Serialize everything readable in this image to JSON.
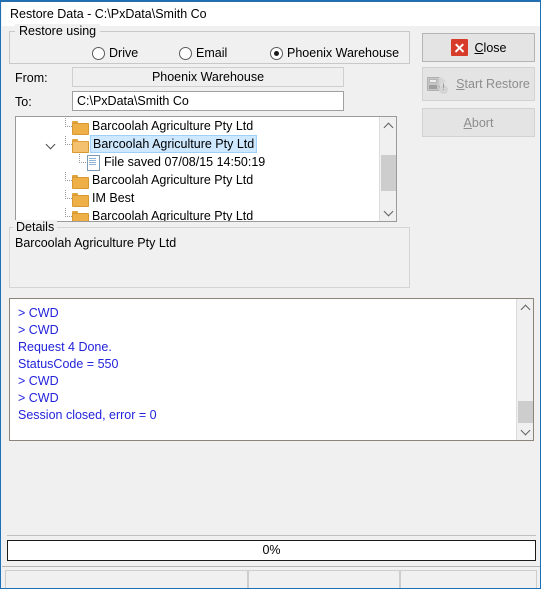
{
  "window": {
    "title": "Restore Data - C:\\PxData\\Smith Co"
  },
  "restore_using": {
    "legend": "Restore using",
    "options": [
      {
        "label": "Drive",
        "selected": false
      },
      {
        "label": "Email",
        "selected": false
      },
      {
        "label": "Phoenix Warehouse",
        "selected": true
      }
    ]
  },
  "fields": {
    "from_label": "From:",
    "from_value": "Phoenix Warehouse",
    "to_label": "To:",
    "to_value": "C:\\PxData\\Smith Co"
  },
  "tree": {
    "rows": [
      {
        "label": "Barcoolah Agriculture Pty Ltd",
        "type": "folder",
        "selected": false,
        "expanded": false
      },
      {
        "label": "Barcoolah Agriculture Pty Ltd",
        "type": "folder-open",
        "selected": true,
        "expanded": true
      },
      {
        "label": "File saved 07/08/15 14:50:19",
        "type": "file",
        "selected": false,
        "expanded": false
      },
      {
        "label": "Barcoolah Agriculture Pty Ltd",
        "type": "folder",
        "selected": false,
        "expanded": false
      },
      {
        "label": "IM Best",
        "type": "folder",
        "selected": false,
        "expanded": false
      },
      {
        "label": "Barcoolah Agriculture Pty Ltd",
        "type": "folder",
        "selected": false,
        "expanded": false
      }
    ]
  },
  "details": {
    "legend": "Details",
    "text": "Barcoolah Agriculture Pty Ltd"
  },
  "log": {
    "lines": [
      "> CWD",
      "> CWD",
      "Request 4 Done.",
      "StatusCode = 550",
      "> CWD",
      "> CWD",
      "Session closed, error = 0"
    ],
    "text_color": "#2323dc"
  },
  "progress": {
    "percent": 0,
    "label": "0%"
  },
  "statusbar": {
    "cells": [
      "",
      "",
      ""
    ]
  },
  "buttons": {
    "close": {
      "label": "Close",
      "accel": "C",
      "enabled": true,
      "icon": "close-x-icon"
    },
    "start_restore": {
      "label": "Start Restore",
      "accel": "S",
      "enabled": false,
      "icon": "usb-restore-icon"
    },
    "abort": {
      "label": "Abort",
      "accel": "A",
      "enabled": false
    }
  },
  "colors": {
    "accent_red": "#d73b2a",
    "folder": "#eeaf46",
    "selection": "#cde8ff",
    "window_border": "#1d70b8",
    "log_text": "#2323dc"
  }
}
